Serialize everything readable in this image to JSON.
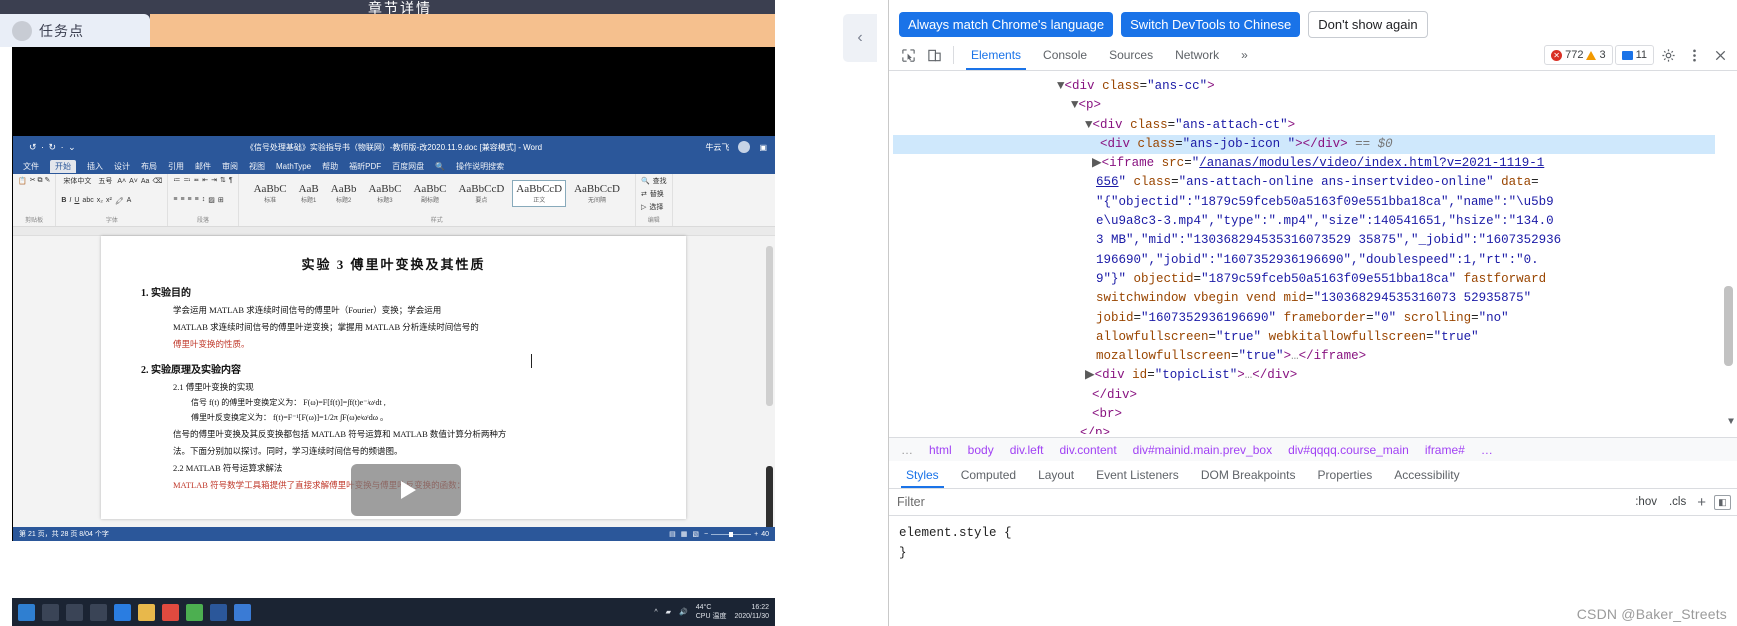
{
  "left_page": {
    "top_title": "章节详情",
    "task_point_label": "任务点",
    "collapse_icon": "chevron-left-icon"
  },
  "word": {
    "title": "《信号处理基础》实验指导书（物联网）-教师版-改2020.11.9.doc [兼容模式] - Word",
    "account_label": "牛云飞",
    "undo_icon": "undo-icon",
    "redo_icon": "redo-icon",
    "ribbon_tabs": [
      "文件",
      "开始",
      "插入",
      "设计",
      "布局",
      "引用",
      "邮件",
      "审阅",
      "视图",
      "MathType",
      "帮助",
      "福昕PDF",
      "百度网盘",
      "操作说明搜索"
    ],
    "active_ribbon_tab": "开始",
    "groups": [
      {
        "name": "剪贴板",
        "items": [
          "粘贴",
          "剪切",
          "复制",
          "格式刷"
        ]
      },
      {
        "name": "字体",
        "items": [
          "宋体中文",
          "五号",
          "B",
          "I",
          "U"
        ]
      },
      {
        "name": "段落",
        "items": []
      },
      {
        "name": "样式",
        "items": []
      },
      {
        "name": "编辑",
        "items": [
          "查找",
          "替换",
          "选择"
        ]
      }
    ],
    "styles": [
      {
        "preview": "AaBbC",
        "label": "标准"
      },
      {
        "preview": "AaB",
        "label": "标题1"
      },
      {
        "preview": "AaBb",
        "label": "标题2"
      },
      {
        "preview": "AaBbC",
        "label": "标题3"
      },
      {
        "preview": "AaBbC",
        "label": "副标题"
      },
      {
        "preview": "AaBbCcD",
        "label": "要点"
      },
      {
        "preview": "AaBbCcD",
        "label": "正文"
      },
      {
        "preview": "AaBbCcD",
        "label": "无间隔"
      }
    ],
    "selected_style": "正文",
    "document": {
      "title": "实验 3   傅里叶变换及其性质",
      "sections": [
        {
          "heading": "1. 实验目的",
          "paras": [
            "学会运用 MATLAB 求连续时间信号的傅里叶（Fourier）变换；学会运用",
            "MATLAB 求连续时间信号的傅里叶逆变换；掌握用 MATLAB 分析连续时间信号的",
            "傅里叶变换的性质。"
          ]
        },
        {
          "heading": "2. 实验原理及实验内容",
          "paras": []
        }
      ],
      "subsection1": "2.1  傅里叶变换的实现",
      "sub1_lines": [
        "信号 f(t) 的傅里叶变换定义为：   F(ω)=F[f(t)]=∫f(t)e⁻ʲωᵗdt ,",
        "傅里叶反变换定义为：   f(t)=F⁻¹[F(ω)]=1/2π ∫F(ω)eʲωᵗdω 。",
        "信号的傅里叶变换及其反变换都包括 MATLAB 符号运算和 MATLAB 数值计算分析两种方",
        "法。下面分别加以探讨。同时，学习连续时间信号的频谱图。"
      ],
      "subsection2": "2.2  MATLAB 符号运算求解法",
      "sub2_line": "MATLAB 符号数学工具箱提供了直接求解傅里叶变换与傅里叶反变换的函数："
    },
    "play_button_icon": "play-icon",
    "status_left": "第 21 页，共 28 页    8/04 个字",
    "status_zoom": "40"
  },
  "taskbar": {
    "start_icon": "windows-start-icon",
    "temp": "44°C",
    "temp_sub": "CPU 温度",
    "time": "16:22",
    "date": "2020/11/30"
  },
  "devtools": {
    "banner": {
      "primary_1": "Always match Chrome's language",
      "primary_2": "Switch DevTools to Chinese",
      "plain": "Don't show again"
    },
    "toolbar": {
      "inspect_icon": "inspect-cursor-icon",
      "device_icon": "device-toolbar-icon",
      "tabs": [
        "Elements",
        "Console",
        "Sources",
        "Network"
      ],
      "active_tab": "Elements",
      "more_tabs_icon": "chevron-double-right-icon",
      "error_count": "772",
      "warning_count": "3",
      "message_count": "11",
      "settings_icon": "gear-icon",
      "menu_icon": "more-vertical-icon",
      "close_icon": "close-icon"
    },
    "dom_lines": [
      {
        "indent": 5,
        "text": "▼<div class=\"ans-cc\">"
      },
      {
        "indent": 6,
        "text": "▼<p>"
      },
      {
        "indent": 7,
        "text": "▼<div class=\"ans-attach-ct\">"
      },
      {
        "indent": 8,
        "text": "<div class=\"ans-job-icon \"></div> == $0",
        "selected": true
      },
      {
        "indent": 8,
        "text": "▶<iframe src=\"/ananas/modules/video/index.html?v=2021-1119-1"
      },
      {
        "indent": 8,
        "text": "656\" class=\"ans-attach-online ans-insertvideo-online\" data="
      },
      {
        "indent": 8,
        "text": "\"{\"objectid\":\"1879c59fceb50a5163f09e551bba18ca\",\"name\":\"\\u5b9"
      },
      {
        "indent": 8,
        "text": "e\\u9a8c3-3.mp4\",\"type\":\".mp4\",\"size\":140541651,\"hsize\":\"134.0"
      },
      {
        "indent": 8,
        "text": "3 MB\",\"mid\":\"130368294535316073529 35875\",\"_jobid\":\"1607352936"
      },
      {
        "indent": 8,
        "text": "196690\",\"jobid\":\"1607352936196690\",\"doublespeed\":1,\"rt\":\"0."
      },
      {
        "indent": 8,
        "text": "9\"}\" objectid=\"1879c59fceb50a5163f09e551bba18ca\" fastforward"
      },
      {
        "indent": 8,
        "text": "switchwindow vbegin vend mid=\"130368294535316073 52935875\""
      },
      {
        "indent": 8,
        "text": "jobid=\"1607352936196690\" frameborder=\"0\" scrolling=\"no\""
      },
      {
        "indent": 8,
        "text": "allowfullscreen=\"true\" webkitallowfullscreen=\"true\""
      },
      {
        "indent": 8,
        "text": "mozallowfullscreen=\"true\">…</iframe>"
      },
      {
        "indent": 7,
        "text": "▶<div id=\"topicList\">…</div>"
      },
      {
        "indent": 7,
        "text": "</div>"
      },
      {
        "indent": 7,
        "text": "<br>"
      },
      {
        "indent": 6,
        "text": "</p>"
      }
    ],
    "breadcrumb": {
      "dots": "…",
      "items": [
        "html",
        "body",
        "div.left",
        "div.content",
        "div#mainid.main.prev_box",
        "div#qqqq.course_main",
        "iframe#",
        "…"
      ]
    },
    "lower_tabs": [
      "Styles",
      "Computed",
      "Layout",
      "Event Listeners",
      "DOM Breakpoints",
      "Properties",
      "Accessibility"
    ],
    "active_lower_tab": "Styles",
    "filter": {
      "placeholder": "Filter",
      "value": "",
      "hov_label": ":hov",
      "cls_label": ".cls",
      "new_rule_icon": "plus-icon",
      "toggle_pane_icon": "sidebar-toggle-icon"
    },
    "styles_pane": {
      "line1": "element.style {",
      "line2": "}"
    }
  },
  "watermark": "CSDN @Baker_Streets",
  "colors": {
    "accent_blue": "#1a73e8",
    "red_highlight": "#ef2424",
    "word_blue": "#2b579a",
    "orange_bar": "#f5c08e",
    "selection_blue": "#cfe8fc"
  }
}
